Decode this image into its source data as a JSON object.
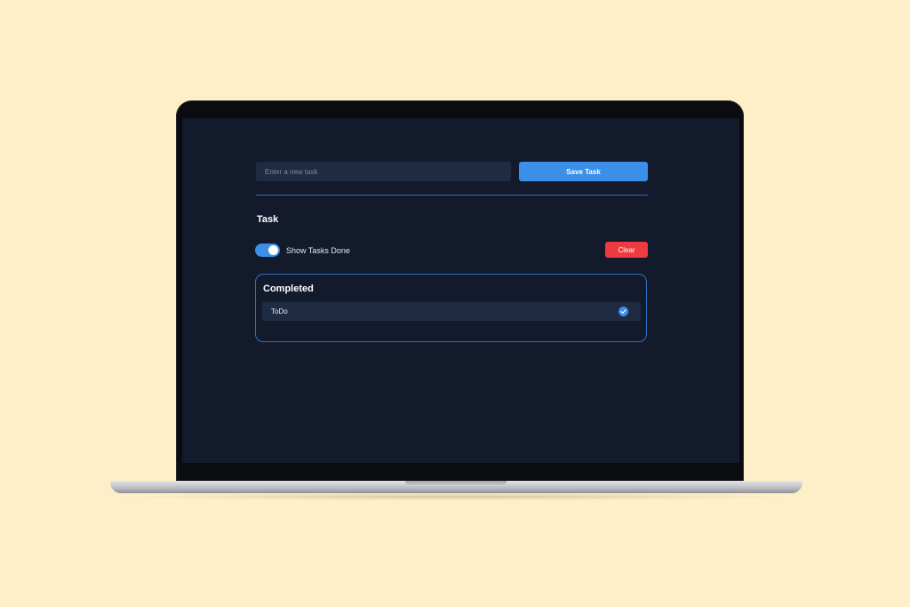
{
  "new_task": {
    "placeholder": "Enter a new task",
    "value": "",
    "save_label": "Save Task"
  },
  "section": {
    "title": "Task"
  },
  "filter": {
    "toggle_label": "Show Tasks Done",
    "toggle_on": true,
    "clear_label": "Clear"
  },
  "completed": {
    "title": "Completed",
    "items": [
      {
        "label": "ToDo",
        "done": true
      }
    ]
  },
  "colors": {
    "page_background": "#FEEFC9",
    "app_background": "#121a2b",
    "accent": "#3b8fe8",
    "danger": "#ef3a3f",
    "field_background": "#1f2b42"
  },
  "icons": {
    "toggle": "toggle-switch",
    "task_status": "check-circle-icon"
  }
}
